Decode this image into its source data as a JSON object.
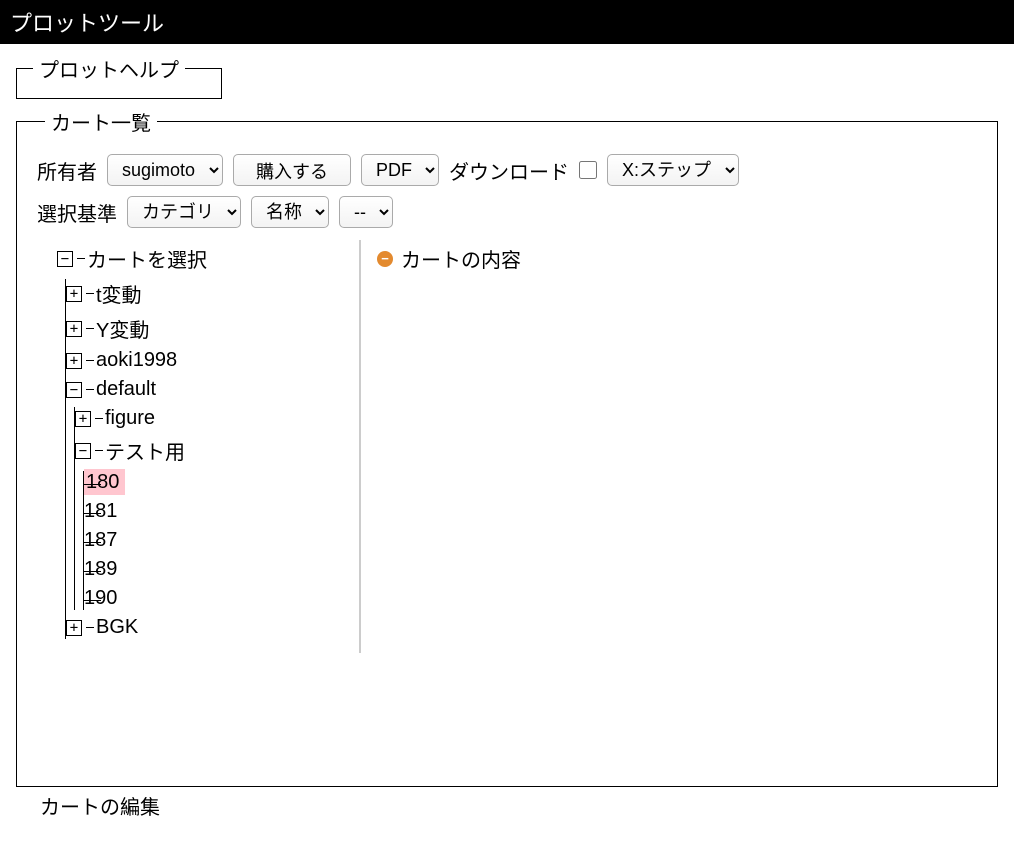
{
  "title": "プロットツール",
  "help": {
    "legend": "プロットヘルプ"
  },
  "cartList": {
    "legend": "カート一覧",
    "row1": {
      "ownerLabel": "所有者",
      "ownerValue": "sugimoto",
      "buyButton": "購入する",
      "formatValue": "PDF",
      "downloadLabel": "ダウンロード",
      "xaxisValue": "X:ステップ"
    },
    "row2": {
      "criteriaLabel": "選択基準",
      "criteriaValue": "カテゴリ",
      "nameValue": "名称",
      "filterValue": "--"
    },
    "tree": {
      "rootLabel": "カートを選択",
      "items": [
        {
          "label": "t変動",
          "expanded": false
        },
        {
          "label": "Y変動",
          "expanded": false
        },
        {
          "label": "aoki1998",
          "expanded": false
        },
        {
          "label": "default",
          "expanded": true
        },
        {
          "label": "BGK",
          "expanded": false
        }
      ],
      "defaultChildren": [
        {
          "label": "figure",
          "expanded": false
        },
        {
          "label": "テスト用",
          "expanded": true
        }
      ],
      "testLeaves": [
        {
          "label": "180",
          "selected": true
        },
        {
          "label": "181",
          "selected": false
        },
        {
          "label": "187",
          "selected": false
        },
        {
          "label": "189",
          "selected": false
        },
        {
          "label": "190",
          "selected": false
        }
      ]
    },
    "content": {
      "heading": "カートの内容"
    }
  },
  "cartEdit": {
    "legend": "カートの編集"
  }
}
